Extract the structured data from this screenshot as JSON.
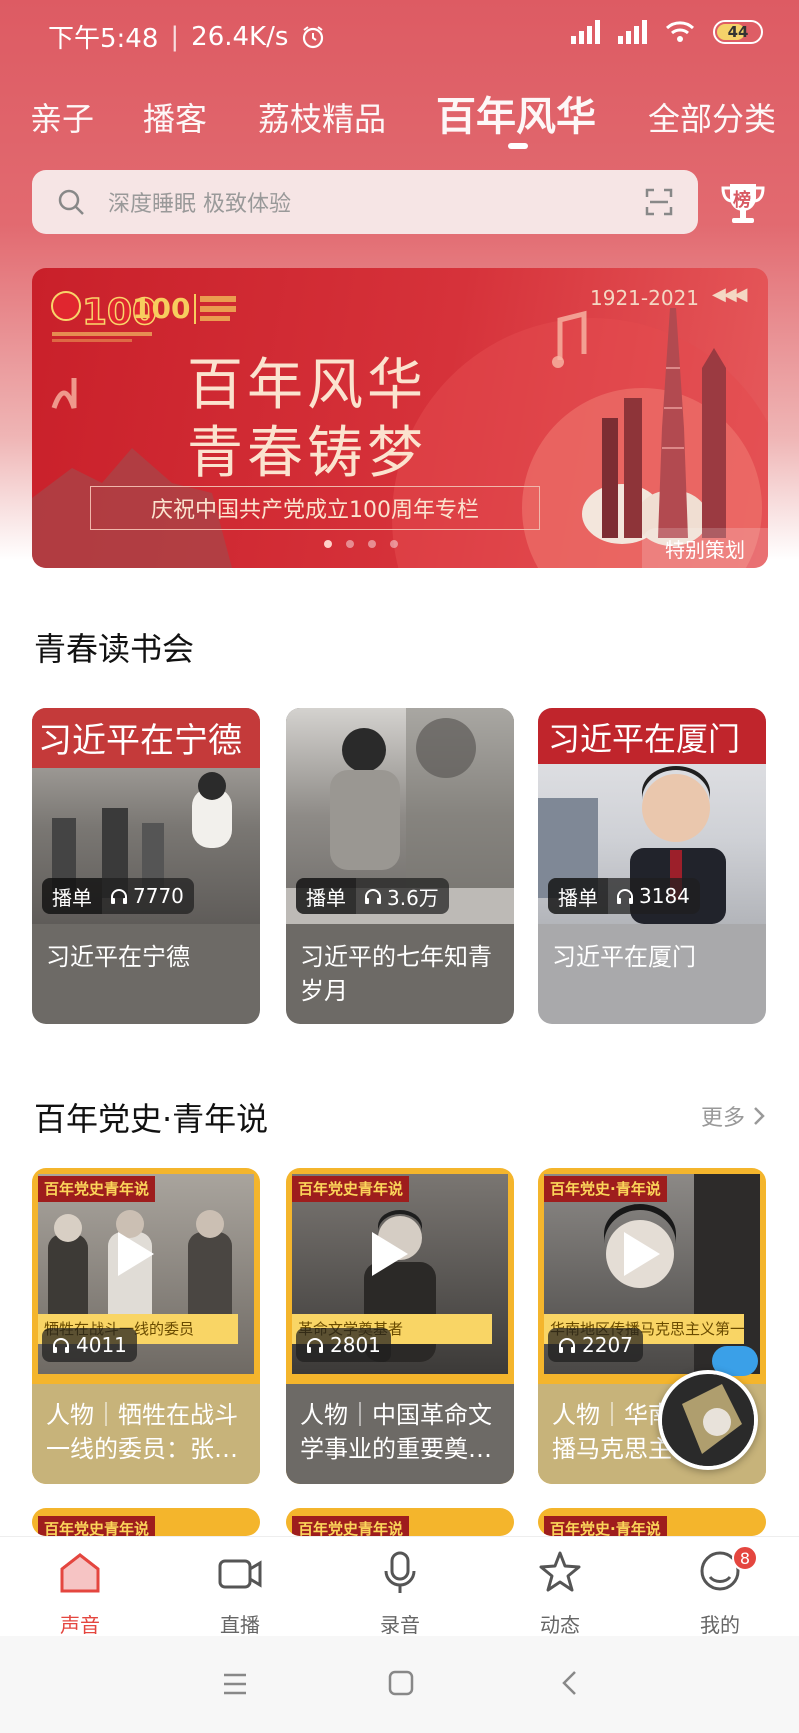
{
  "status": {
    "time": "下午5:48",
    "speed": "26.4K/s",
    "battery": "44"
  },
  "tabs": [
    {
      "label": "亲子"
    },
    {
      "label": "播客"
    },
    {
      "label": "荔枝精品"
    },
    {
      "label": "百年风华",
      "active": true
    },
    {
      "label": "全部分类"
    }
  ],
  "search": {
    "placeholder": "深度睡眠 极致体验"
  },
  "trophy": {
    "label": "榜"
  },
  "banner": {
    "years": "1921-2021",
    "title1": "百年风华",
    "title2": "青春铸梦",
    "subtitle": "庆祝中国共产党成立100周年专栏",
    "tag": "特别策划",
    "logo_text": "100"
  },
  "section1": {
    "title": "青春读书会",
    "cards": [
      {
        "type": "播单",
        "plays": "7770",
        "title": "习近平在宁德",
        "img_text": "习近平在宁德"
      },
      {
        "type": "播单",
        "plays": "3.6万",
        "title": "习近平的七年知青岁月",
        "img_text": ""
      },
      {
        "type": "播单",
        "plays": "3184",
        "title": "习近平在厦门",
        "img_text": "习近平在厦门"
      }
    ]
  },
  "section2": {
    "title": "百年党史·青年说",
    "more": "更多",
    "cards": [
      {
        "top": "百年党史青年说",
        "strip": "牺牲在战斗一线的委员",
        "plays": "4011",
        "title": "人物｜牺牲在战斗一线的委员：张…"
      },
      {
        "top": "百年党史青年说",
        "strip": "革命文学奠基者",
        "plays": "2801",
        "title": "人物｜中国革命文学事业的重要奠…"
      },
      {
        "top": "百年党史·青年说",
        "strip": "华南地区传播马克思主义第一人",
        "plays": "2207",
        "title": "人物｜华南地区传播马克思主…"
      }
    ]
  },
  "nav": [
    {
      "label": "声音",
      "icon": "home-icon",
      "active": true
    },
    {
      "label": "直播",
      "icon": "video-icon"
    },
    {
      "label": "录音",
      "icon": "mic-icon"
    },
    {
      "label": "动态",
      "icon": "star-icon"
    },
    {
      "label": "我的",
      "icon": "profile-icon",
      "badge": "8"
    }
  ],
  "colors": {
    "accent": "#e4463f",
    "header": "#dd5b63",
    "banner": "#c9202a"
  }
}
